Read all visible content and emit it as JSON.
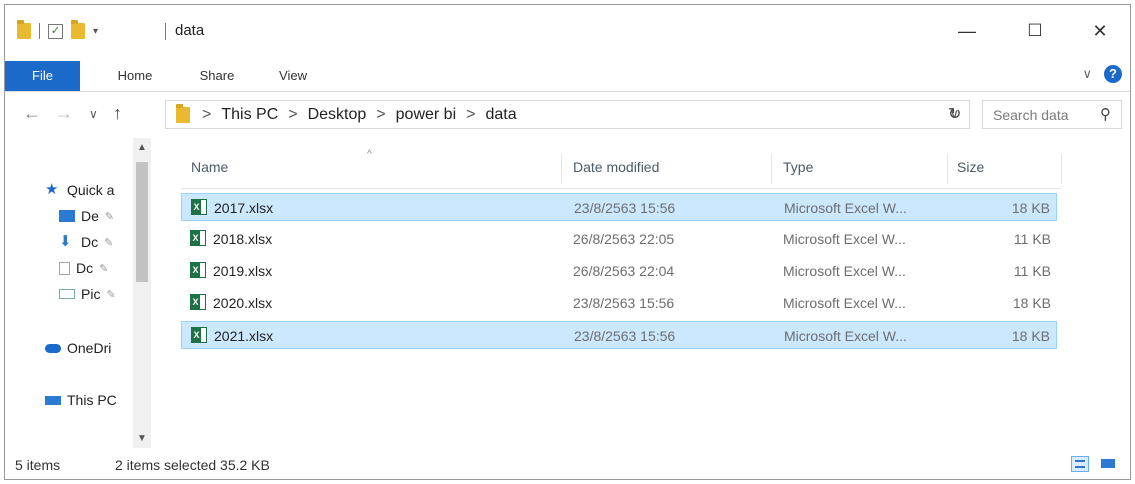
{
  "window": {
    "title": "data",
    "minimize": "—",
    "maximize": "☐",
    "close": "✕"
  },
  "ribbon": {
    "tabs": [
      "File",
      "Home",
      "Share",
      "View"
    ],
    "help": "?"
  },
  "nav": {
    "back": "←",
    "forward": "→",
    "recent": "∨",
    "up": "↑",
    "breadcrumb": [
      "This PC",
      "Desktop",
      "power bi",
      "data"
    ],
    "separator": ">",
    "dropdown": "∨",
    "refresh": "↻",
    "search_placeholder": "Search data",
    "search_icon": "⚲"
  },
  "navpane": {
    "items": [
      {
        "label": "Quick a",
        "icon": "star-icon",
        "color": "#1b6ac9"
      },
      {
        "label": "De",
        "icon": "desktop-icon",
        "pin": "📌",
        "color": "#2b79d0"
      },
      {
        "label": "Dc",
        "icon": "download-icon",
        "pin": "📌",
        "color": "#2b79d0"
      },
      {
        "label": "Dc",
        "icon": "document-icon",
        "pin": "📌",
        "color": "#9aa"
      },
      {
        "label": "Pic",
        "icon": "pictures-icon",
        "pin": "📌",
        "color": "#7aa"
      },
      {
        "label": "OneDri",
        "icon": "cloud-icon",
        "color": "#1b6ac9"
      },
      {
        "label": "This PC",
        "icon": "computer-icon",
        "color": "#2b79d0"
      }
    ],
    "scroll_up": "▲",
    "scroll_down": "▼"
  },
  "list": {
    "columns": [
      "Name",
      "Date modified",
      "Type",
      "Size"
    ],
    "sort_indicator": "^",
    "rows": [
      {
        "name": "2017.xlsx",
        "date": "23/8/2563 15:56",
        "type": "Microsoft Excel W...",
        "size": "18 KB",
        "selected": true
      },
      {
        "name": "2018.xlsx",
        "date": "26/8/2563 22:05",
        "type": "Microsoft Excel W...",
        "size": "11 KB",
        "selected": false
      },
      {
        "name": "2019.xlsx",
        "date": "26/8/2563 22:04",
        "type": "Microsoft Excel W...",
        "size": "11 KB",
        "selected": false
      },
      {
        "name": "2020.xlsx",
        "date": "23/8/2563 15:56",
        "type": "Microsoft Excel W...",
        "size": "18 KB",
        "selected": false
      },
      {
        "name": "2021.xlsx",
        "date": "23/8/2563 15:56",
        "type": "Microsoft Excel W...",
        "size": "18 KB",
        "selected": true
      }
    ]
  },
  "status": {
    "count": "5 items",
    "selection": "2 items selected  35.2 KB"
  }
}
